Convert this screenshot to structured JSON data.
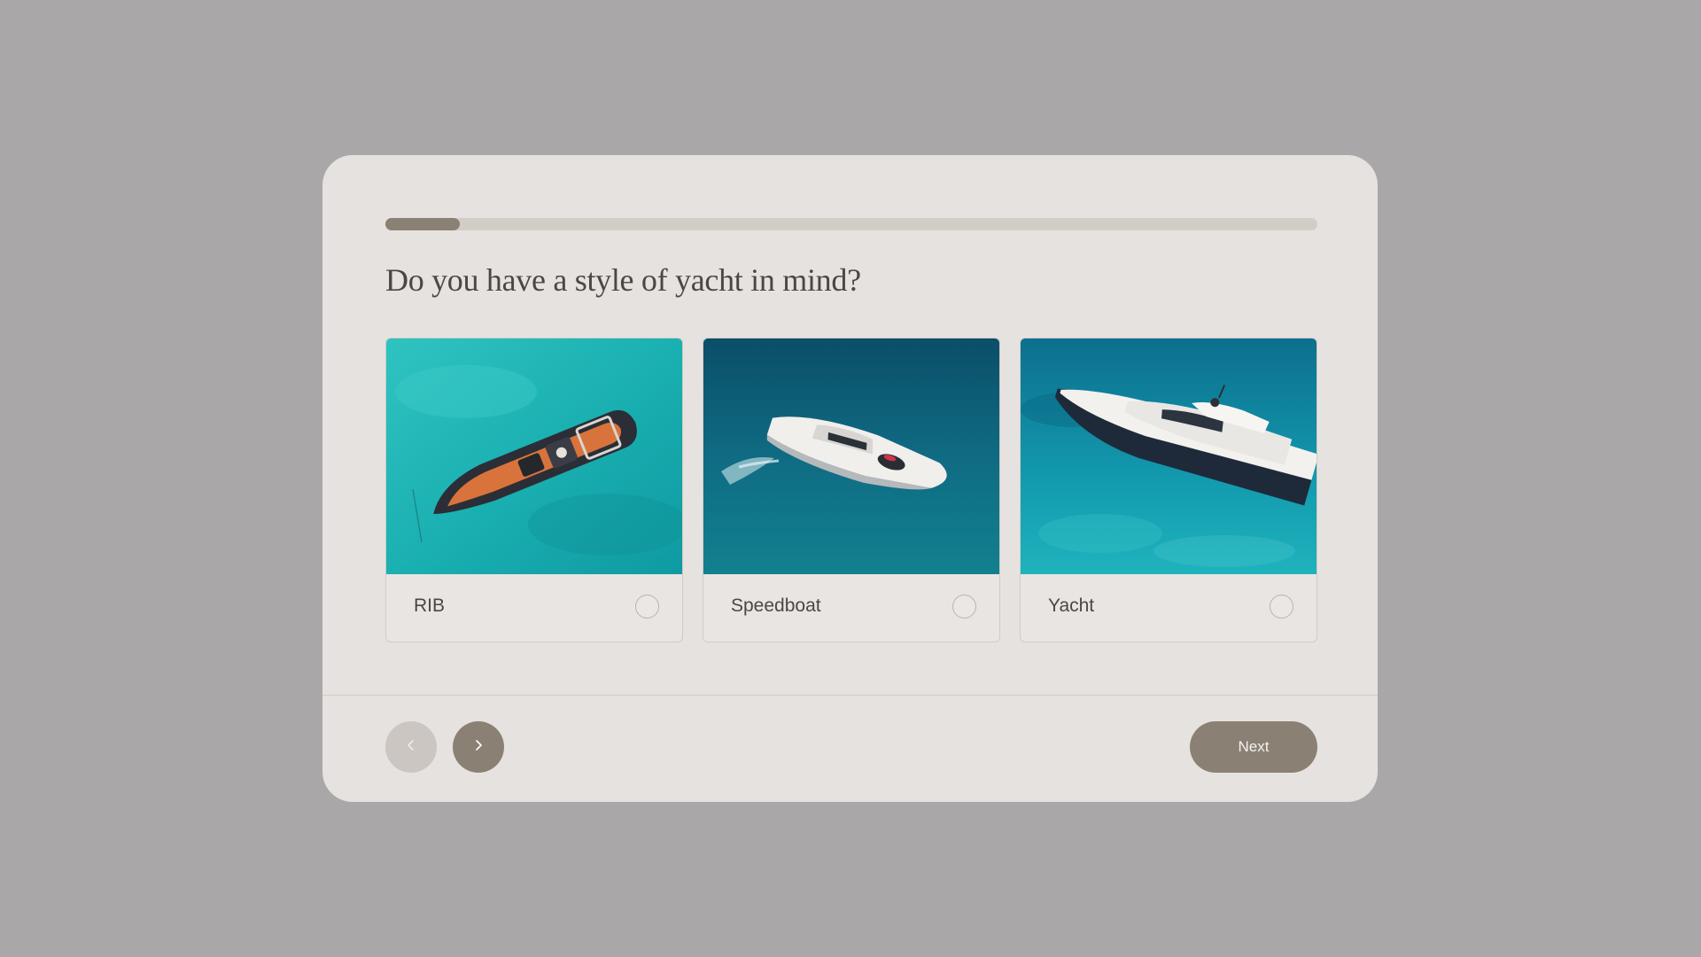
{
  "progress": {
    "value": 0.08
  },
  "question": {
    "title": "Do you have a style of yacht in mind?"
  },
  "options": [
    {
      "label": "RIB",
      "selected": false,
      "image": "rib-boat-aerial-photo"
    },
    {
      "label": "Speedboat",
      "selected": false,
      "image": "speedboat-aerial-photo"
    },
    {
      "label": "Yacht",
      "selected": false,
      "image": "yacht-aerial-photo"
    }
  ],
  "footer": {
    "prev_icon": "chevron-left-icon",
    "next_icon": "chevron-right-icon",
    "next_label": "Next"
  },
  "colors": {
    "background": "#a9a7a8",
    "modal": "#e6e2df",
    "accent": "#8a8174",
    "track": "#d3cdc8",
    "disabled_button": "#cbc6c1"
  }
}
